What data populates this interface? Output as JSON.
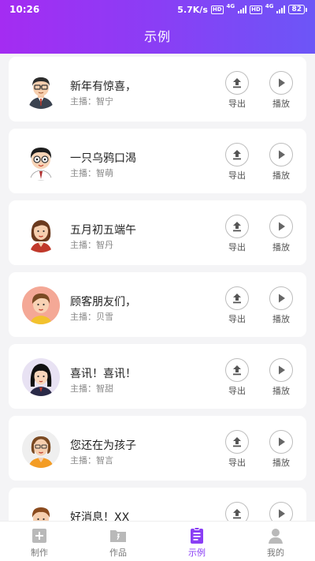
{
  "status_bar": {
    "time": "10:26",
    "net_speed": "5.7K/s",
    "hd1": "HD",
    "net1": "4G",
    "hd2": "HD",
    "net2": "4G",
    "battery": "82"
  },
  "header": {
    "title": "示例"
  },
  "actions": {
    "export_label": "导出",
    "play_label": "播放"
  },
  "items": [
    {
      "title": "新年有惊喜，",
      "anchor": "主播：智宁",
      "avatar": "man-glasses-suit-avatar"
    },
    {
      "title": "一只乌鸦口渴",
      "anchor": "主播：智萌",
      "avatar": "boy-glasses-avatar"
    },
    {
      "title": "五月初五端午",
      "anchor": "主播：智丹",
      "avatar": "woman-brown-hair-avatar"
    },
    {
      "title": "顾客朋友们，",
      "anchor": "主播：贝雪",
      "avatar": "girl-pink-background-avatar"
    },
    {
      "title": "喜讯！喜讯！",
      "anchor": "主播：智甜",
      "avatar": "girl-long-black-hair-avatar"
    },
    {
      "title": "您还在为孩子",
      "anchor": "主播：智言",
      "avatar": "woman-orange-shirt-avatar"
    },
    {
      "title": "好消息！XX",
      "anchor": "",
      "avatar": "boy-brown-hair-avatar"
    }
  ],
  "tabs": [
    {
      "label": "制作",
      "icon": "create-icon",
      "active": false
    },
    {
      "label": "作品",
      "icon": "folder-icon",
      "active": false
    },
    {
      "label": "示例",
      "icon": "clipboard-icon",
      "active": true
    },
    {
      "label": "我的",
      "icon": "profile-icon",
      "active": false
    }
  ],
  "colors": {
    "accent": "#8a3ef5",
    "gradient_start": "#a42cf2",
    "gradient_end": "#6c56f7"
  }
}
